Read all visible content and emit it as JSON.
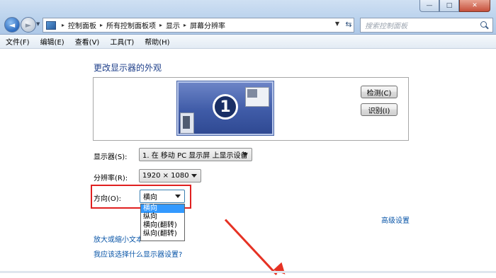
{
  "window": {
    "controls": {
      "minimize": "—",
      "maximize": "□",
      "close": "✕"
    }
  },
  "nav": {
    "back_glyph": "◄",
    "forward_glyph": "►",
    "dropdown_glyph": "▼"
  },
  "address": {
    "breadcrumbs": [
      {
        "label": "控制面板"
      },
      {
        "label": "所有控制面板项"
      },
      {
        "label": "显示"
      },
      {
        "label": "屏幕分辨率"
      }
    ],
    "separator": "▸"
  },
  "search": {
    "placeholder": "搜索控制面板"
  },
  "menu": {
    "items": [
      {
        "label": "文件(F)"
      },
      {
        "label": "编辑(E)"
      },
      {
        "label": "查看(V)"
      },
      {
        "label": "工具(T)"
      },
      {
        "label": "帮助(H)"
      }
    ]
  },
  "page": {
    "title": "更改显示器的外观"
  },
  "preview": {
    "monitor_number": "1",
    "detect_label": "检测(C)",
    "identify_label": "识别(I)"
  },
  "settings": {
    "display": {
      "label": "显示器(S):",
      "value": "1. 在 移动 PC 显示屏 上显示设备"
    },
    "resolution": {
      "label": "分辨率(R):",
      "value": "1920 × 1080"
    },
    "orientation": {
      "label": "方向(O):",
      "value": "横向",
      "options": [
        {
          "label": "横向",
          "selected": true
        },
        {
          "label": "纵向",
          "selected": false
        },
        {
          "label": "横向(翻转)",
          "selected": false
        },
        {
          "label": "纵向(翻转)",
          "selected": false
        }
      ]
    }
  },
  "links": {
    "advanced": "高级设置",
    "text_size": "放大或缩小文本",
    "which_setting": "我应该选择什么显示器设置?"
  },
  "colors": {
    "annotation": "#e02020",
    "link": "#0a56a8",
    "title": "#1e3f8a",
    "selection": "#3399ff"
  }
}
